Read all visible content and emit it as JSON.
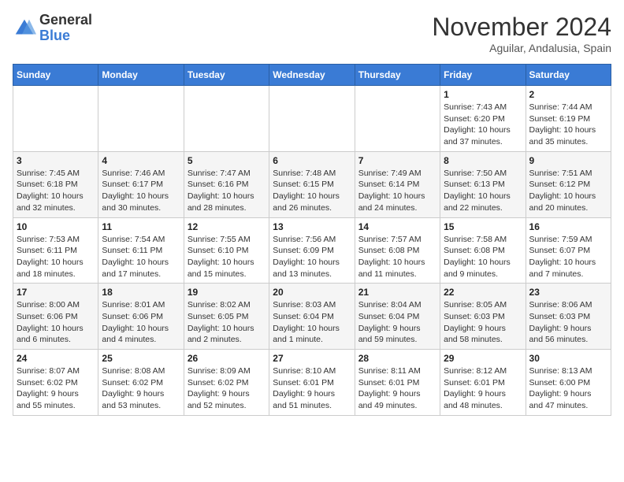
{
  "header": {
    "logo": {
      "general": "General",
      "blue": "Blue"
    },
    "title": "November 2024",
    "location": "Aguilar, Andalusia, Spain"
  },
  "calendar": {
    "days_of_week": [
      "Sunday",
      "Monday",
      "Tuesday",
      "Wednesday",
      "Thursday",
      "Friday",
      "Saturday"
    ],
    "weeks": [
      [
        {
          "day": "",
          "info": ""
        },
        {
          "day": "",
          "info": ""
        },
        {
          "day": "",
          "info": ""
        },
        {
          "day": "",
          "info": ""
        },
        {
          "day": "",
          "info": ""
        },
        {
          "day": "1",
          "info": "Sunrise: 7:43 AM\nSunset: 6:20 PM\nDaylight: 10 hours\nand 37 minutes."
        },
        {
          "day": "2",
          "info": "Sunrise: 7:44 AM\nSunset: 6:19 PM\nDaylight: 10 hours\nand 35 minutes."
        }
      ],
      [
        {
          "day": "3",
          "info": "Sunrise: 7:45 AM\nSunset: 6:18 PM\nDaylight: 10 hours\nand 32 minutes."
        },
        {
          "day": "4",
          "info": "Sunrise: 7:46 AM\nSunset: 6:17 PM\nDaylight: 10 hours\nand 30 minutes."
        },
        {
          "day": "5",
          "info": "Sunrise: 7:47 AM\nSunset: 6:16 PM\nDaylight: 10 hours\nand 28 minutes."
        },
        {
          "day": "6",
          "info": "Sunrise: 7:48 AM\nSunset: 6:15 PM\nDaylight: 10 hours\nand 26 minutes."
        },
        {
          "day": "7",
          "info": "Sunrise: 7:49 AM\nSunset: 6:14 PM\nDaylight: 10 hours\nand 24 minutes."
        },
        {
          "day": "8",
          "info": "Sunrise: 7:50 AM\nSunset: 6:13 PM\nDaylight: 10 hours\nand 22 minutes."
        },
        {
          "day": "9",
          "info": "Sunrise: 7:51 AM\nSunset: 6:12 PM\nDaylight: 10 hours\nand 20 minutes."
        }
      ],
      [
        {
          "day": "10",
          "info": "Sunrise: 7:53 AM\nSunset: 6:11 PM\nDaylight: 10 hours\nand 18 minutes."
        },
        {
          "day": "11",
          "info": "Sunrise: 7:54 AM\nSunset: 6:11 PM\nDaylight: 10 hours\nand 17 minutes."
        },
        {
          "day": "12",
          "info": "Sunrise: 7:55 AM\nSunset: 6:10 PM\nDaylight: 10 hours\nand 15 minutes."
        },
        {
          "day": "13",
          "info": "Sunrise: 7:56 AM\nSunset: 6:09 PM\nDaylight: 10 hours\nand 13 minutes."
        },
        {
          "day": "14",
          "info": "Sunrise: 7:57 AM\nSunset: 6:08 PM\nDaylight: 10 hours\nand 11 minutes."
        },
        {
          "day": "15",
          "info": "Sunrise: 7:58 AM\nSunset: 6:08 PM\nDaylight: 10 hours\nand 9 minutes."
        },
        {
          "day": "16",
          "info": "Sunrise: 7:59 AM\nSunset: 6:07 PM\nDaylight: 10 hours\nand 7 minutes."
        }
      ],
      [
        {
          "day": "17",
          "info": "Sunrise: 8:00 AM\nSunset: 6:06 PM\nDaylight: 10 hours\nand 6 minutes."
        },
        {
          "day": "18",
          "info": "Sunrise: 8:01 AM\nSunset: 6:06 PM\nDaylight: 10 hours\nand 4 minutes."
        },
        {
          "day": "19",
          "info": "Sunrise: 8:02 AM\nSunset: 6:05 PM\nDaylight: 10 hours\nand 2 minutes."
        },
        {
          "day": "20",
          "info": "Sunrise: 8:03 AM\nSunset: 6:04 PM\nDaylight: 10 hours\nand 1 minute."
        },
        {
          "day": "21",
          "info": "Sunrise: 8:04 AM\nSunset: 6:04 PM\nDaylight: 9 hours\nand 59 minutes."
        },
        {
          "day": "22",
          "info": "Sunrise: 8:05 AM\nSunset: 6:03 PM\nDaylight: 9 hours\nand 58 minutes."
        },
        {
          "day": "23",
          "info": "Sunrise: 8:06 AM\nSunset: 6:03 PM\nDaylight: 9 hours\nand 56 minutes."
        }
      ],
      [
        {
          "day": "24",
          "info": "Sunrise: 8:07 AM\nSunset: 6:02 PM\nDaylight: 9 hours\nand 55 minutes."
        },
        {
          "day": "25",
          "info": "Sunrise: 8:08 AM\nSunset: 6:02 PM\nDaylight: 9 hours\nand 53 minutes."
        },
        {
          "day": "26",
          "info": "Sunrise: 8:09 AM\nSunset: 6:02 PM\nDaylight: 9 hours\nand 52 minutes."
        },
        {
          "day": "27",
          "info": "Sunrise: 8:10 AM\nSunset: 6:01 PM\nDaylight: 9 hours\nand 51 minutes."
        },
        {
          "day": "28",
          "info": "Sunrise: 8:11 AM\nSunset: 6:01 PM\nDaylight: 9 hours\nand 49 minutes."
        },
        {
          "day": "29",
          "info": "Sunrise: 8:12 AM\nSunset: 6:01 PM\nDaylight: 9 hours\nand 48 minutes."
        },
        {
          "day": "30",
          "info": "Sunrise: 8:13 AM\nSunset: 6:00 PM\nDaylight: 9 hours\nand 47 minutes."
        }
      ]
    ]
  }
}
